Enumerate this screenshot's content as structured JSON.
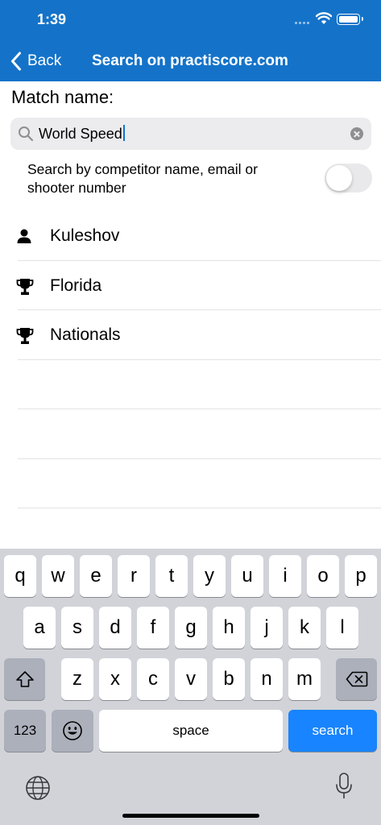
{
  "status_bar": {
    "time": "1:39"
  },
  "nav": {
    "back_label": "Back",
    "title": "Search on practiscore.com"
  },
  "form": {
    "match_label": "Match name:",
    "search_value": "World Speed",
    "toggle_label": "Search by competitor name, email or shooter number",
    "toggle_on": false
  },
  "results": [
    {
      "label": "Kuleshov",
      "icon": "person-icon"
    },
    {
      "label": "Florida",
      "icon": "trophy-icon"
    },
    {
      "label": "Nationals",
      "icon": "trophy-icon"
    }
  ],
  "keyboard": {
    "row1": [
      "q",
      "w",
      "e",
      "r",
      "t",
      "y",
      "u",
      "i",
      "o",
      "p"
    ],
    "row2": [
      "a",
      "s",
      "d",
      "f",
      "g",
      "h",
      "j",
      "k",
      "l"
    ],
    "row3": [
      "z",
      "x",
      "c",
      "v",
      "b",
      "n",
      "m"
    ],
    "numbers_label": "123",
    "space_label": "space",
    "search_label": "search"
  },
  "colors": {
    "accent": "#1473c9",
    "keyboard_bg": "#d1d3d9",
    "search_key": "#1884ff"
  }
}
